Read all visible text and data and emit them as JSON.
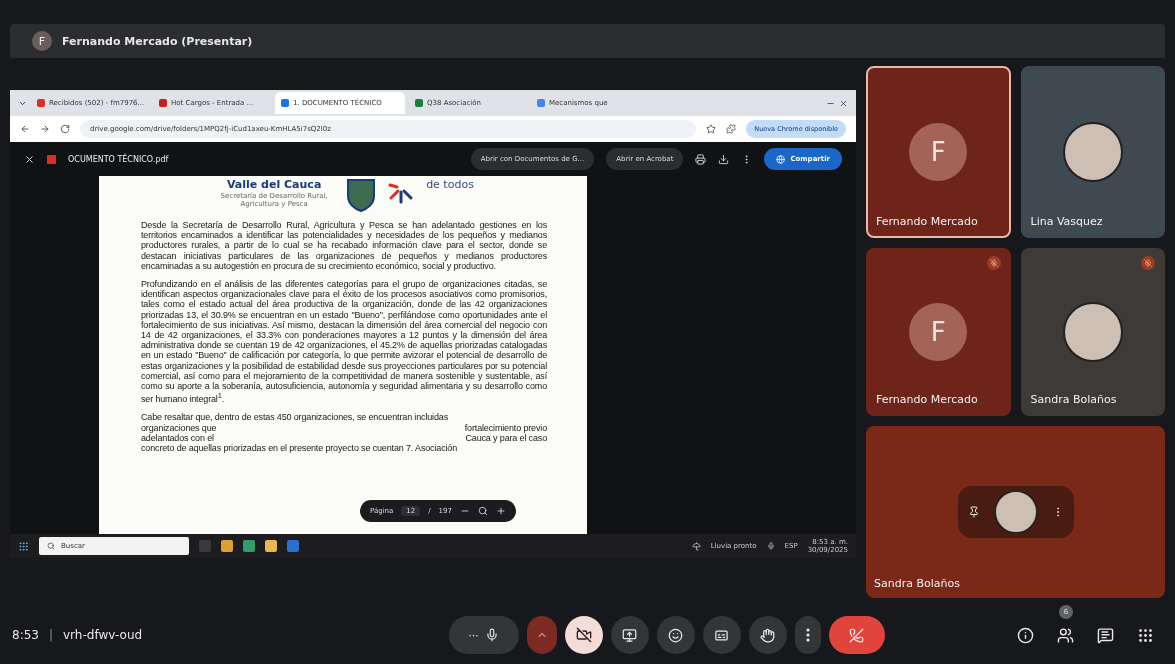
{
  "meet": {
    "presenter_initial": "F",
    "presenter_title": "Fernando Mercado (Presentar)"
  },
  "browser": {
    "tabs": [
      {
        "label": "Recibidos (502) - fm7976...",
        "selected": false
      },
      {
        "label": "Hot Cargos - Entrada ...",
        "selected": false
      },
      {
        "label": "1. DOCUMENTO TÉCNICO",
        "selected": true
      },
      {
        "label": "Q38 Asociación",
        "selected": false
      },
      {
        "label": "Mecanismos que",
        "selected": false
      }
    ],
    "url": "drive.google.com/drive/folders/1MPQ2fj-iCud1axeu-KmHLA5i7sQ2l0z",
    "update_button": "Nueva Chrome disponible"
  },
  "pdf_toolbar": {
    "filename": "OCUMENTO TÉCNICO.pdf",
    "open_with": "Abrir con Documentos de G...",
    "acrobat": "Abrir en Acrobat",
    "share": "Compartir"
  },
  "document": {
    "logo_title": "Valle del Cauca",
    "logo_subtitle": "Secretaría de Desarrollo Rural, Agricultura y Pesca",
    "logo_right": "de todos",
    "paragraphs": [
      "Desde la Secretaría de Desarrollo Rural, Agricultura y Pesca se han adelantado gestiones en los territorios encaminados a identificar las potencialidades y necesidades de los pequeños y medianos productores rurales, a partir de lo cual se ha recabado información clave para el sector, donde se destacan iniciativas particulares de las organizaciones de pequeños y medianos productores encaminadas a su autogestión en procura de su crecimiento económico, social y productivo.",
      "Profundizando en el análisis de las diferentes categorías para el grupo de organizaciones citadas, se identifican aspectos organizacionales clave para el éxito de los procesos asociativos como promisorios, tales como el estado actual del área productiva de la organización, donde de las 42 organizaciones priorizadas 13, el 30.9% se encuentran en un estado \"Bueno\", perfilándose como oportunidades ante el fortalecimiento de sus iniciativas. Así mismo, destacan la dimensión del área comercial del negocio con 14 de 42 organizaciones, el 33.3% con ponderaciones mayores a 12 puntos y la dimensión del área administrativa donde se cuentan 19 de 42 organizaciones, el 45.2% de aquellas priorizadas catalogadas en un estado \"Bueno\" de calificación por categoría, lo que permite avizorar el potencial de desarrollo de estas organizaciones y la posibilidad de estabilidad desde sus proyecciones particulares por su potencial comercial, así como para el mejoramiento de la competitividad de manera sostenible y sustentable, así como su aporte a la soberanía, autosuficiencia, autonomía y seguridad alimentaria y su desarrollo como ser humano integral$^{1}$."
    ],
    "last_lines": [
      [
        "Cabe resaltar que, dentro de estas 450 organizaciones, se encuentran incluidas"
      ],
      [
        "organizaciones que",
        "fortalecimiento previo"
      ],
      [
        "adelantados con el",
        "Cauca y para el caso"
      ],
      [
        "concreto de aquellas priorizadas en el presente proyecto se cuentan 7. Asociación"
      ]
    ]
  },
  "pager": {
    "label": "Página",
    "page": "12",
    "separator": "/",
    "total": "197"
  },
  "taskbar": {
    "search_placeholder": "Buscar",
    "weather": "Lluvia pronto",
    "language": "ESP",
    "time": "8:53 a. m.",
    "date": "30/09/2025"
  },
  "tiles": [
    {
      "name": "Fernando Mercado",
      "kind": "initial",
      "initial": "F",
      "speaking": true,
      "muted": false
    },
    {
      "name": "Lina Vasquez",
      "kind": "photo",
      "speaking": false,
      "muted": false
    },
    {
      "name": "Fernando Mercado",
      "kind": "initial",
      "initial": "F",
      "speaking": false,
      "muted": true
    },
    {
      "name": "Sandra Bolaños",
      "kind": "photo",
      "speaking": false,
      "muted": true
    }
  ],
  "featured_tile": {
    "name": "Sandra Bolaños"
  },
  "bottom_bar": {
    "time": "8:53",
    "separator": "|",
    "meeting_code": "vrh-dfwv-oud",
    "camera_on": false,
    "more_label": "···",
    "people_count": "6"
  }
}
